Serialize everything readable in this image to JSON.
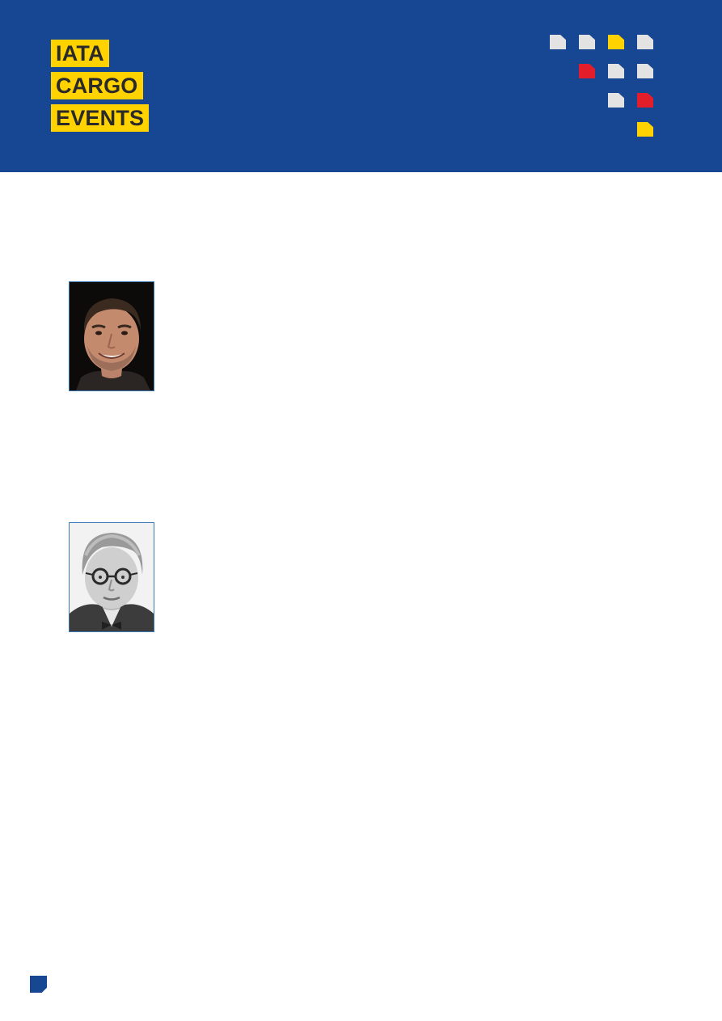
{
  "header": {
    "logo_lines": [
      "IATA",
      "CARGO",
      "EVENTS"
    ],
    "colors": {
      "background": "#174693",
      "logo_yellow": "#ffd200",
      "logo_text": "#2a2a2a",
      "tile_grey": "#e3e3e3",
      "tile_yellow": "#ffd200",
      "tile_red": "#e31e2a"
    }
  },
  "photos": [
    {
      "name": "speaker-photo-1"
    },
    {
      "name": "speaker-photo-2"
    }
  ]
}
